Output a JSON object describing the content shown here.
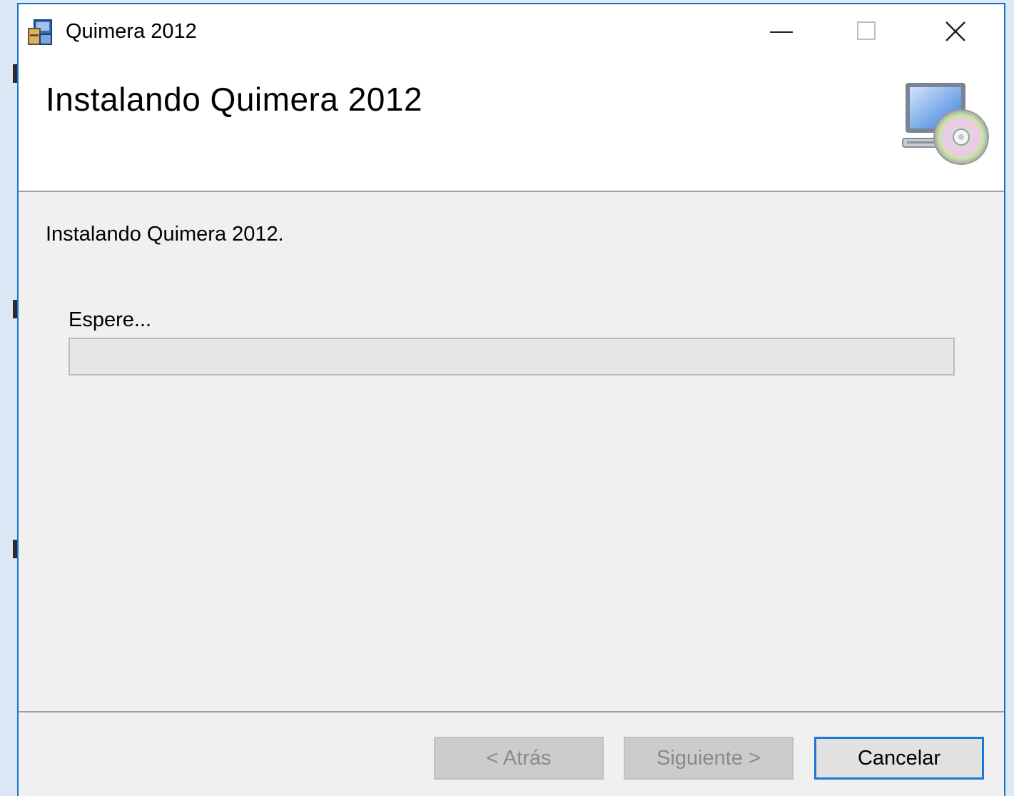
{
  "window": {
    "title": "Quimera 2012",
    "icon": "installer-package-icon"
  },
  "titlebar_buttons": {
    "minimize_icon": "minimize-icon",
    "maximize_icon": "maximize-icon",
    "close_icon": "close-icon"
  },
  "header": {
    "title": "Instalando Quimera 2012",
    "graphic": "computer-cd-icon"
  },
  "body": {
    "status_text": "Instalando Quimera 2012.",
    "progress_label": "Espere...",
    "progress_value": 0
  },
  "footer": {
    "back_label": "< Atrás",
    "next_label": "Siguiente >",
    "cancel_label": "Cancelar"
  },
  "colors": {
    "window_border": "#1b73c9",
    "dialog_background": "#f0f0f0",
    "header_background": "#ffffff",
    "focus_border": "#1c78d4",
    "progress_fill": "#06b025"
  }
}
